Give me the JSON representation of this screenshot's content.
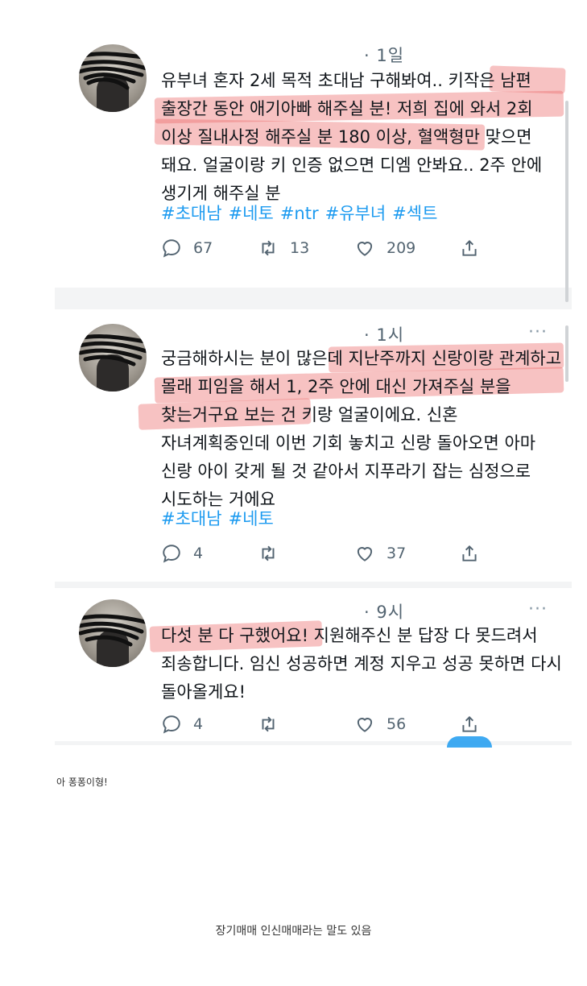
{
  "tweets": [
    {
      "time": "· 1일",
      "text": "유부녀 혼자 2세 목적 초대남 구해봐여.. 키작은 남편 출장간 동안 애기아빠 해주실 분! 저희 집에 와서 2회 이상 질내사정 해주실 분 180 이상, 혈액형만 맞으면 돼요. 얼굴이랑 키 인증 없으면 디엠 안봐요.. 2주 안에 생기게 해주실 분",
      "tags": [
        "#초대남",
        "#네토",
        "#ntr",
        "#유부녀",
        "#섹트"
      ],
      "replies": "67",
      "retweets": "13",
      "likes": "209"
    },
    {
      "time": "· 1시",
      "text": "궁금해하시는 분이 많은데 지난주까지 신랑이랑 관계하고 몰래 피임을 해서 1, 2주 안에 대신 가져주실 분을 찾는거구요 보는 건 키랑 얼굴이에요. 신혼 자녀계획중인데 이번 기회 놓치고 신랑 돌아오면 아마 신랑 아이 갖게 될 것 같아서 지푸라기 잡는 심정으로 시도하는 거에요",
      "tags": [
        "#초대남",
        "#네토"
      ],
      "replies": "4",
      "retweets": "",
      "likes": "37"
    },
    {
      "time": "· 9시",
      "text": "다섯 분 다 구했어요! 지원해주신 분 답장 다 못드려서 죄송합니다. 임신 성공하면 계정 지우고 성공 못하면 다시 돌아올게요!",
      "tags": [],
      "replies": "4",
      "retweets": "",
      "likes": "56"
    }
  ],
  "more_label": "···",
  "caption_1": "아 퐁퐁이형!",
  "caption_2": "장기매매 인신매매라는 말도 있음",
  "colors": {
    "accent": "#1d9bf0",
    "highlight": "#ec6e6e",
    "muted": "#536471"
  },
  "icons": [
    "reply-icon",
    "retweet-icon",
    "like-icon",
    "share-icon"
  ]
}
